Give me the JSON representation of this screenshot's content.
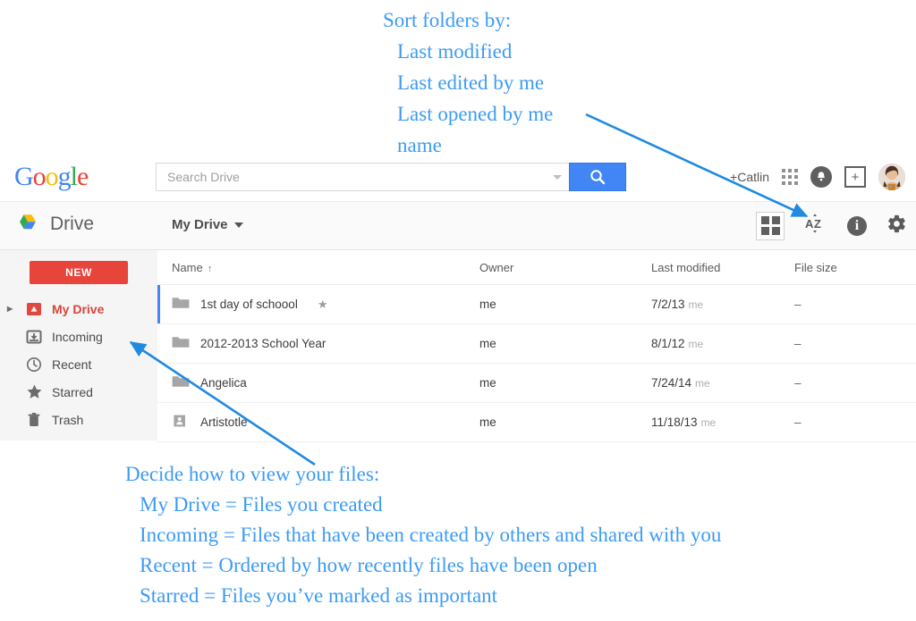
{
  "annotations": {
    "top": [
      "Sort folders by:",
      "Last modified",
      "Last edited by me",
      "Last opened by me",
      "name"
    ],
    "bottom": [
      "Decide how to view your files:",
      "My Drive = Files you created",
      "Incoming = Files that have been created by others and shared with you",
      "Recent = Ordered by how recently files have been open",
      "Starred = Files you’ve marked as important"
    ],
    "color": "#3d9bf4"
  },
  "google_bar": {
    "logo": "Google",
    "logo_letters": [
      "G",
      "o",
      "o",
      "g",
      "l",
      "e"
    ],
    "search": {
      "placeholder": "Search Drive",
      "value": ""
    },
    "account_label": "+Catlin",
    "icons": [
      "apps-grid-icon",
      "bell-icon",
      "share-icon",
      "avatar"
    ]
  },
  "drive_bar": {
    "product_name": "Drive",
    "breadcrumb": "My Drive",
    "icons": [
      "grid-view-icon",
      "sort-az-icon",
      "info-icon",
      "settings-gear-icon"
    ],
    "sort_label": "A Z"
  },
  "sidebar": {
    "new_button": "NEW",
    "items": [
      {
        "label": "My Drive",
        "icon": "drive-icon",
        "active": true,
        "expandable": true
      },
      {
        "label": "Incoming",
        "icon": "incoming-icon",
        "active": false,
        "expandable": false
      },
      {
        "label": "Recent",
        "icon": "clock-icon",
        "active": false,
        "expandable": false
      },
      {
        "label": "Starred",
        "icon": "star-icon",
        "active": false,
        "expandable": false
      },
      {
        "label": "Trash",
        "icon": "trash-icon",
        "active": false,
        "expandable": false
      }
    ]
  },
  "file_list": {
    "columns": [
      "Name",
      "Owner",
      "Last modified",
      "File size"
    ],
    "sort_indicator": "↑",
    "rows": [
      {
        "name": "1st day of schoool",
        "icon": "folder-icon",
        "starred": true,
        "owner": "me",
        "modified": "7/2/13",
        "modified_by": "me",
        "size": "–",
        "selected": true
      },
      {
        "name": "2012-2013 School Year",
        "icon": "folder-icon",
        "starred": false,
        "owner": "me",
        "modified": "8/1/12",
        "modified_by": "me",
        "size": "–",
        "selected": false
      },
      {
        "name": "Angelica",
        "icon": "folder-icon",
        "starred": false,
        "owner": "me",
        "modified": "7/24/14",
        "modified_by": "me",
        "size": "–",
        "selected": false
      },
      {
        "name": "Artistotle",
        "icon": "shared-folder-icon",
        "starred": false,
        "owner": "me",
        "modified": "11/18/13",
        "modified_by": "me",
        "size": "–",
        "selected": false
      }
    ]
  }
}
